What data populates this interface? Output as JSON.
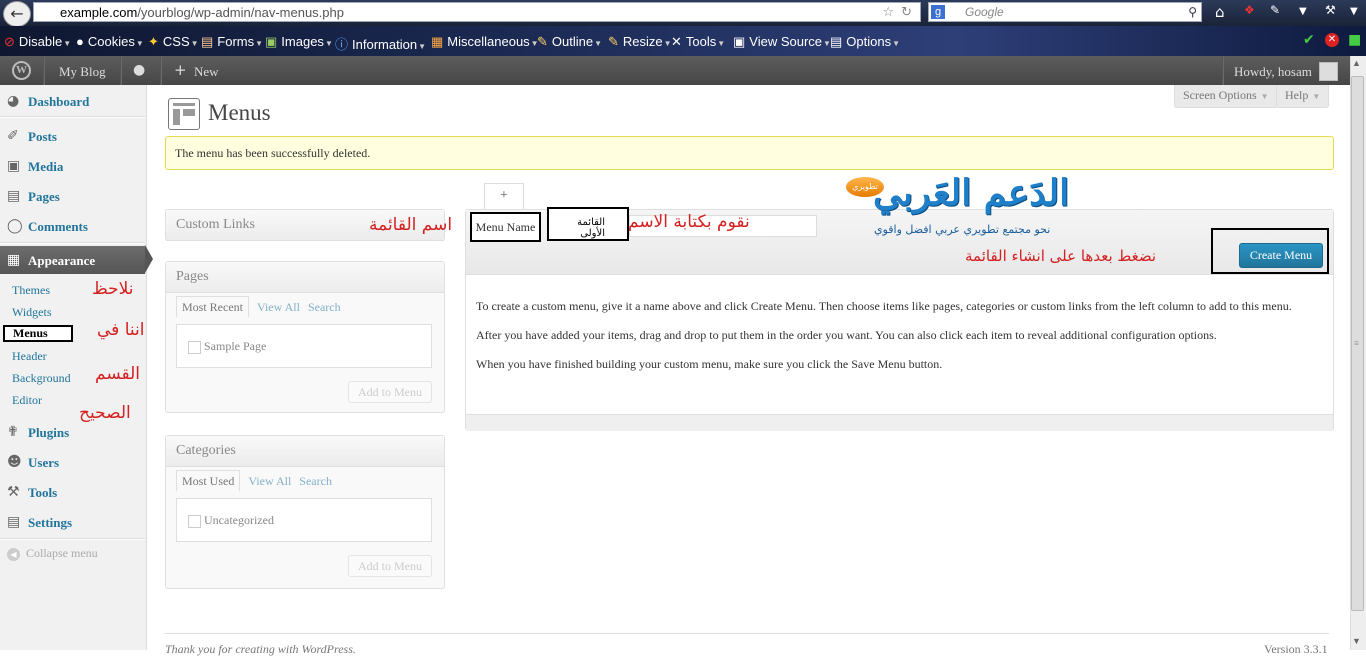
{
  "browser": {
    "url_domain": "example.com",
    "url_path": "/yourblog/wp-admin/nav-menus.php",
    "search_placeholder": "Google"
  },
  "toolbar": {
    "items": [
      "Disable",
      "Cookies",
      "CSS",
      "Forms",
      "Images",
      "Information",
      "Miscellaneous",
      "Outline",
      "Resize",
      "Tools",
      "View Source",
      "Options"
    ]
  },
  "adminbar": {
    "site_name": "My Blog",
    "new_label": "New",
    "howdy": "Howdy, hosam"
  },
  "sidebar": {
    "dashboard": "Dashboard",
    "posts": "Posts",
    "media": "Media",
    "pages": "Pages",
    "comments": "Comments",
    "appearance": "Appearance",
    "sub": [
      "Themes",
      "Widgets",
      "Menus",
      "Header",
      "Background",
      "Editor"
    ],
    "plugins": "Plugins",
    "users": "Users",
    "tools": "Tools",
    "settings": "Settings",
    "collapse": "Collapse menu"
  },
  "header": {
    "title": "Menus",
    "screen_options": "Screen Options",
    "help": "Help",
    "notice": "The menu has been successfully deleted."
  },
  "metaboxes": {
    "custom_links": "Custom Links",
    "pages": {
      "title": "Pages",
      "tabs": [
        "Most Recent",
        "View All",
        "Search"
      ],
      "item": "Sample Page",
      "button": "Add to Menu"
    },
    "categories": {
      "title": "Categories",
      "tabs": [
        "Most Used",
        "View All",
        "Search"
      ],
      "item": "Uncategorized",
      "button": "Add to Menu"
    }
  },
  "menu_editor": {
    "add_tab": "+",
    "name_label": "Menu Name",
    "name_value": "القائمة الأولى",
    "create_button": "Create Menu",
    "instructions": [
      "To create a custom menu, give it a name above and click Create Menu. Then choose items like pages, categories or custom links from the left column to add to this menu.",
      "After you have added your items, drag and drop to put them in the order you want. You can also click each item to reveal additional configuration options.",
      "When you have finished building your custom menu, make sure you click the Save Menu button."
    ]
  },
  "annotations": {
    "menu_name": "اسم القائمة",
    "write_name": "نقوم بكتابة الاسم",
    "click_create": "نضغط بعدها على انشاء القائمة",
    "note_lines": [
      "نلاحظ",
      "اننا في",
      "القسم",
      "الصحيح"
    ]
  },
  "logo": {
    "main": "الدَعم العَربي",
    "sub": "نحو مجتمع تطويري عربي افضل واقوي",
    "badge": "تطويري"
  },
  "footer": {
    "thanks": "Thank you for creating with WordPress.",
    "version": "Version 3.3.1"
  },
  "colors": {
    "accent": "#21759b",
    "annotation": "#d42020",
    "notice_bg": "#ffffe0"
  }
}
